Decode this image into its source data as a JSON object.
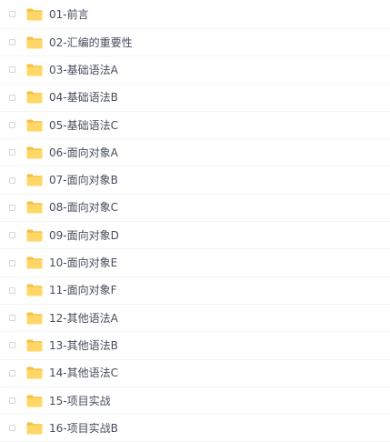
{
  "files": [
    {
      "name": "01-前言",
      "icon": "folder-icon"
    },
    {
      "name": "02-汇编的重要性",
      "icon": "folder-icon"
    },
    {
      "name": "03-基础语法A",
      "icon": "folder-icon"
    },
    {
      "name": "04-基础语法B",
      "icon": "folder-icon"
    },
    {
      "name": "05-基础语法C",
      "icon": "folder-icon"
    },
    {
      "name": "06-面向对象A",
      "icon": "folder-icon"
    },
    {
      "name": "07-面向对象B",
      "icon": "folder-icon"
    },
    {
      "name": "08-面向对象C",
      "icon": "folder-icon"
    },
    {
      "name": "09-面向对象D",
      "icon": "folder-icon"
    },
    {
      "name": "10-面向对象E",
      "icon": "folder-icon"
    },
    {
      "name": "11-面向对象F",
      "icon": "folder-icon"
    },
    {
      "name": "12-其他语法A",
      "icon": "folder-icon"
    },
    {
      "name": "13-其他语法B",
      "icon": "folder-icon"
    },
    {
      "name": "14-其他语法C",
      "icon": "folder-icon"
    },
    {
      "name": "15-项目实战",
      "icon": "folder-icon"
    },
    {
      "name": "16-项目实战B",
      "icon": "folder-icon"
    }
  ],
  "colors": {
    "folder_body": "#ffd766",
    "folder_tab": "#f5c042",
    "text": "#454d5a",
    "checkbox_border": "#d3d6dc",
    "row_divider": "#f3f4f6"
  }
}
